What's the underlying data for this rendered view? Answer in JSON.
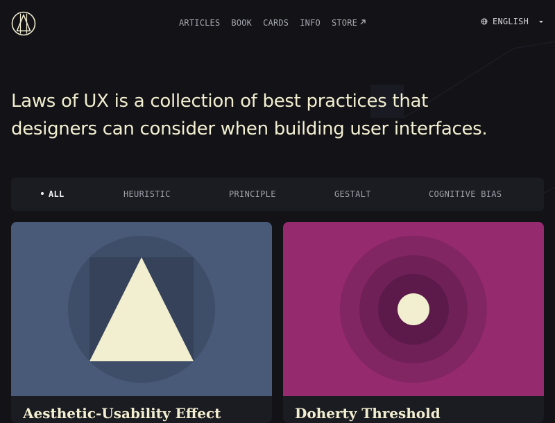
{
  "colors": {
    "background": "#121217",
    "cream": "#f2eed0",
    "card1_bg": "#485a78",
    "card2_bg": "#962a6f",
    "filter_bar_bg": "#1b1c22"
  },
  "header": {
    "logo_icon": "triangle-in-circle-icon",
    "nav": [
      {
        "label": "ARTICLES"
      },
      {
        "label": "BOOK"
      },
      {
        "label": "CARDS"
      },
      {
        "label": "INFO"
      },
      {
        "label": "STORE",
        "icon": "external-arrow-icon"
      }
    ],
    "language": {
      "label": "ENGLISH",
      "icon": "globe-icon",
      "caret": "caret-down-icon"
    }
  },
  "hero": {
    "text": "Laws of UX is a collection of best practices that designers can consider when building user interfaces."
  },
  "filters": [
    {
      "label": "ALL",
      "active": true
    },
    {
      "label": "HEURISTIC",
      "active": false
    },
    {
      "label": "PRINCIPLE",
      "active": false
    },
    {
      "label": "GESTALT",
      "active": false
    },
    {
      "label": "COGNITIVE BIAS",
      "active": false
    }
  ],
  "cards": [
    {
      "title": "Aesthetic-Usability Effect",
      "illustration": "triangle-on-square-in-circle"
    },
    {
      "title": "Doherty Threshold",
      "illustration": "concentric-circles"
    }
  ]
}
